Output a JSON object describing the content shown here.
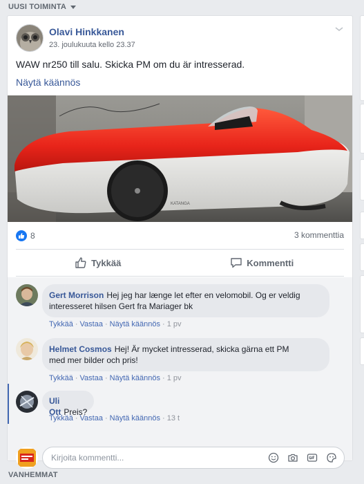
{
  "feed": {
    "section_title": "UUSI TOIMINTA",
    "footer_label": "VANHEMMAT"
  },
  "post": {
    "author": "Olavi Hinkkanen",
    "timestamp": "23. joulukuuta kello 23.37",
    "text": "WAW nr250 till salu. Skicka PM om du är intresserad.",
    "translate_label": "Näytä käännös",
    "image_caption_mark": "KATANGA",
    "reaction_count": "8",
    "comments_count_label": "3 kommenttia",
    "like_button_label": "Tykkää",
    "comment_button_label": "Kommentti"
  },
  "comments": [
    {
      "author": "Gert Morrison",
      "text_line1": "Hej jeg har længe let efter en velomobil. Og er veldig",
      "text_line2": "interesseret hilsen Gert fra Mariager bk",
      "like_label": "Tykkää",
      "reply_label": "Vastaa",
      "translate_label": "Näytä käännös",
      "time": "1 pv"
    },
    {
      "author": "Helmet Cosmos",
      "text_line1": "Hej! Är mycket intresserad, skicka gärna ett PM",
      "text_line2": "med mer bilder och pris!",
      "like_label": "Tykkää",
      "reply_label": "Vastaa",
      "translate_label": "Näytä käännös",
      "time": "1 pv"
    },
    {
      "author": "Uli Ott",
      "text_line1": "Preis?",
      "like_label": "Tykkää",
      "reply_label": "Vastaa",
      "translate_label": "Näytä käännös",
      "time": "13 t"
    }
  ],
  "composer": {
    "placeholder": "Kirjoita kommentti...",
    "icons": [
      "emoji-icon",
      "camera-icon",
      "gif-icon",
      "sticker-icon"
    ]
  },
  "colors": {
    "link": "#385898",
    "like_blue": "#1877f2",
    "background": "#e9ebee",
    "velomobile_red": "#e8241a"
  }
}
